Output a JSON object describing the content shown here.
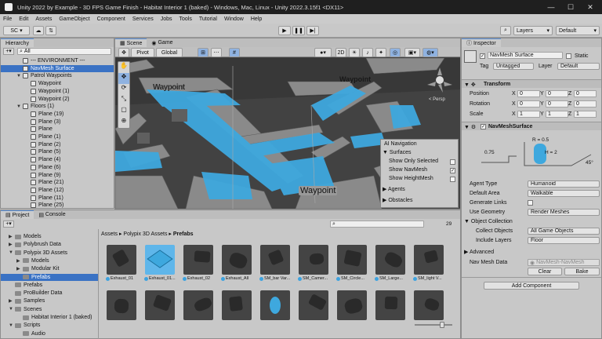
{
  "window": {
    "title": "Unity 2022 by Example - 3D FPS Game Finish - Habitat Interior 1 (baked) - Windows, Mac, Linux - Unity 2022.3.15f1 <DX11>",
    "min": "—",
    "max": "☐",
    "close": "✕"
  },
  "menu": [
    "File",
    "Edit",
    "Assets",
    "GameObject",
    "Component",
    "Services",
    "Jobs",
    "Tools",
    "Tutorial",
    "Window",
    "Help"
  ],
  "toolbar": {
    "account": "SC",
    "layers": "Layers",
    "layout": "Default",
    "play": "▶",
    "pause": "❚❚",
    "step": "▶|"
  },
  "hierarchy": {
    "tab": "Hierarchy",
    "search": "All",
    "rows": [
      {
        "t": "--- ENVIRONMENT ---",
        "d": 2,
        "a": ""
      },
      {
        "t": "NavMesh Surface",
        "d": 2,
        "a": "",
        "sel": true
      },
      {
        "t": "Patrol Waypoints",
        "d": 2,
        "a": "▼"
      },
      {
        "t": "Waypoint",
        "d": 3,
        "a": ""
      },
      {
        "t": "Waypoint (1)",
        "d": 3,
        "a": ""
      },
      {
        "t": "Waypoint (2)",
        "d": 3,
        "a": ""
      },
      {
        "t": "Floors (1)",
        "d": 2,
        "a": "▼"
      },
      {
        "t": "Plane (19)",
        "d": 3,
        "a": ""
      },
      {
        "t": "Plane (3)",
        "d": 3,
        "a": ""
      },
      {
        "t": "Plane",
        "d": 3,
        "a": ""
      },
      {
        "t": "Plane (1)",
        "d": 3,
        "a": ""
      },
      {
        "t": "Plane (2)",
        "d": 3,
        "a": ""
      },
      {
        "t": "Plane (5)",
        "d": 3,
        "a": ""
      },
      {
        "t": "Plane (4)",
        "d": 3,
        "a": ""
      },
      {
        "t": "Plane (6)",
        "d": 3,
        "a": ""
      },
      {
        "t": "Plane (9)",
        "d": 3,
        "a": ""
      },
      {
        "t": "Plane (21)",
        "d": 3,
        "a": ""
      },
      {
        "t": "Plane (12)",
        "d": 3,
        "a": ""
      },
      {
        "t": "Plane (11)",
        "d": 3,
        "a": ""
      },
      {
        "t": "Plane (25)",
        "d": 3,
        "a": ""
      }
    ]
  },
  "scene": {
    "tab_scene": "Scene",
    "tab_game": "Game",
    "pivot": "Pivot",
    "global": "Global",
    "mode": "2D",
    "persp": "< Persp",
    "waypoint": "Waypoint",
    "ai": {
      "title": "AI Navigation",
      "surfaces": "Surfaces",
      "show_only_selected": "Show Only Selected",
      "show_navmesh": "Show NavMesh",
      "show_heightmesh": "Show HeightMesh",
      "agents": "Agents",
      "obstacles": "Obstacles"
    }
  },
  "inspector": {
    "tab": "Inspector",
    "name": "NavMesh Surface",
    "static": "Static",
    "tag_label": "Tag",
    "tag": "Untagged",
    "layer_label": "Layer",
    "layer": "Default",
    "transform": {
      "title": "Transform",
      "position": "Position",
      "rotation": "Rotation",
      "scale": "Scale",
      "pos": [
        "0",
        "0",
        "0"
      ],
      "rot": [
        "0",
        "0",
        "0"
      ],
      "scl": [
        "1",
        "1",
        "1"
      ],
      "x": "X",
      "y": "Y",
      "z": "Z"
    },
    "navmesh": {
      "title": "NavMeshSurface",
      "r": "R = 0.5",
      "h": "H = 2",
      "step": "0.75",
      "angle": "45°",
      "agent_type_label": "Agent Type",
      "agent_type": "Humanoid",
      "default_area_label": "Default Area",
      "default_area": "Walkable",
      "gen_links": "Generate Links",
      "use_geometry_label": "Use Geometry",
      "use_geometry": "Render Meshes",
      "object_collection": "Object Collection",
      "collect_objects_label": "Collect Objects",
      "collect_objects": "All Game Objects",
      "include_layers_label": "Include Layers",
      "include_layers": "Floor",
      "advanced": "Advanced",
      "nav_mesh_data": "Nav Mesh Data",
      "nav_mesh_value": "NavMesh-NavMesh",
      "clear": "Clear",
      "bake": "Bake"
    },
    "add_component": "Add Component"
  },
  "project": {
    "tab_project": "Project",
    "tab_console": "Console",
    "count": "29",
    "tree": [
      {
        "t": "Models",
        "d": 1,
        "a": "▶"
      },
      {
        "t": "Polybrush Data",
        "d": 1,
        "a": "▶"
      },
      {
        "t": "Polypix 3D Assets",
        "d": 1,
        "a": "▼"
      },
      {
        "t": "Models",
        "d": 2,
        "a": "▶"
      },
      {
        "t": "Modular Kit",
        "d": 2,
        "a": "▶"
      },
      {
        "t": "Prefabs",
        "d": 2,
        "a": "",
        "sel": true
      },
      {
        "t": "Prefabs",
        "d": 1,
        "a": ""
      },
      {
        "t": "ProBuilder Data",
        "d": 1,
        "a": ""
      },
      {
        "t": "Samples",
        "d": 1,
        "a": "▶"
      },
      {
        "t": "Scenes",
        "d": 1,
        "a": "▼"
      },
      {
        "t": "Habitat Interior 1 (baked)",
        "d": 2,
        "a": ""
      },
      {
        "t": "Scripts",
        "d": 1,
        "a": "▼"
      },
      {
        "t": "Audio",
        "d": 2,
        "a": ""
      }
    ],
    "breadcrumb": [
      "Assets",
      "Polypix 3D Assets",
      "Prefabs"
    ],
    "assets": [
      "Exhaust_01",
      "Exhaust_01...",
      "Exhaust_02",
      "Exhaust_All",
      "SM_bar Var...",
      "SM_Camer...",
      "SM_Circle...",
      "SM_Large...",
      "SM_light V..."
    ]
  },
  "colors": {
    "accent": "#3a72c4",
    "navmesh": "#3ea8de"
  }
}
